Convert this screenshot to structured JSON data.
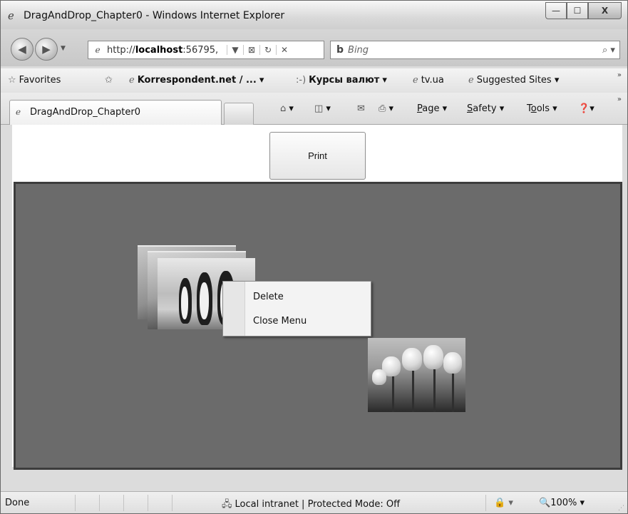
{
  "window": {
    "title": "DragAndDrop_Chapter0 - Windows Internet Explorer",
    "controls": {
      "minimize": "—",
      "maximize": "☐",
      "close": "X"
    }
  },
  "navigation": {
    "url_prefix": "http://",
    "url_host": "localhost",
    "url_port": ":56795,",
    "search_placeholder": "Bing",
    "search_logo": "b"
  },
  "favorites_bar": {
    "favorites_label": "Favorites",
    "items": [
      {
        "label": "Korrespondent.net / ...",
        "icon": "ie-page-icon"
      },
      {
        "label": "Курсы валют",
        "icon": "smiley-icon"
      },
      {
        "label": "tv.ua",
        "icon": "ie-page-icon"
      },
      {
        "label": "Suggested Sites",
        "icon": "ie-page-icon"
      }
    ]
  },
  "tabs": {
    "active_tab_label": "DragAndDrop_Chapter0"
  },
  "command_bar": {
    "page": "Page",
    "safety": "Safety",
    "tools": "Tools"
  },
  "page": {
    "print_button_label": "Print",
    "context_menu": {
      "items": [
        "Delete",
        "Close Menu"
      ]
    }
  },
  "status_bar": {
    "status": "Done",
    "zone": "Local intranet | Protected Mode: Off",
    "zoom": "100%"
  }
}
